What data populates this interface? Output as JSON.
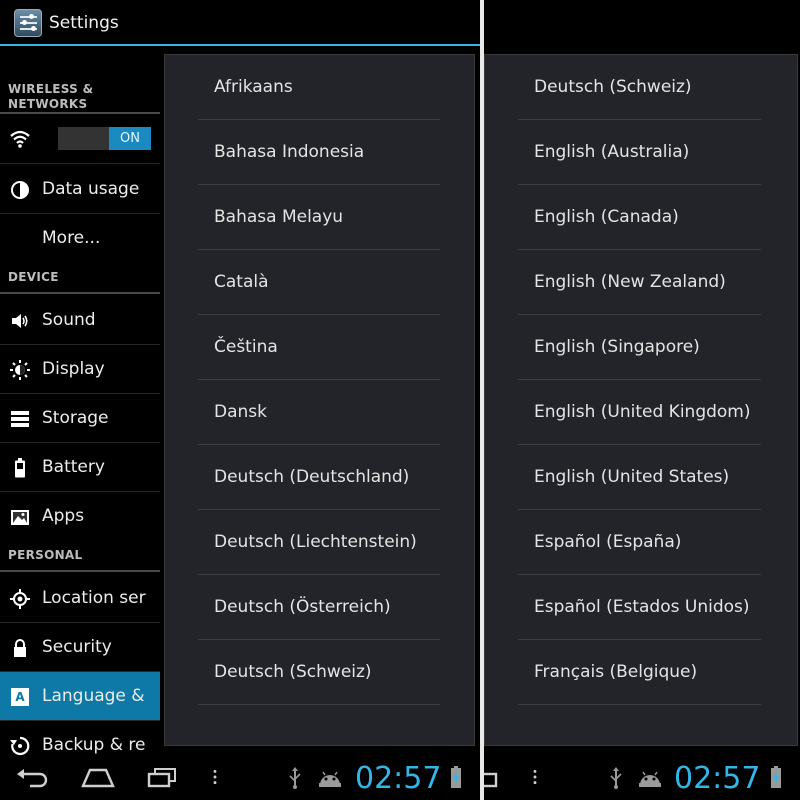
{
  "left_screen": {
    "title": "Settings",
    "sections": [
      {
        "header": "WIRELESS &\nNETWORKS"
      },
      {
        "header": "DEVICE"
      },
      {
        "header": "PERSONAL"
      }
    ],
    "wifi_toggle": "ON",
    "menu": {
      "data_usage": "Data usage",
      "more": "More...",
      "sound": "Sound",
      "display": "Display",
      "storage": "Storage",
      "battery": "Battery",
      "apps": "Apps",
      "location": "Location services",
      "security": "Security",
      "language": "Language & input",
      "backup": "Backup & reset"
    },
    "languages": [
      "Afrikaans",
      "Bahasa Indonesia",
      "Bahasa Melayu",
      "Català",
      "Čeština",
      "Dansk",
      "Deutsch (Deutschland)",
      "Deutsch (Liechtenstein)",
      "Deutsch (Österreich)",
      "Deutsch (Schweiz)"
    ],
    "clock": "02:57"
  },
  "right_screen": {
    "languages": [
      "Deutsch (Schweiz)",
      "English (Australia)",
      "English (Canada)",
      "English (New Zealand)",
      "English (Singapore)",
      "English (United Kingdom)",
      "English (United States)",
      "Español (España)",
      "Español (Estados Unidos)",
      "Français (Belgique)"
    ],
    "clock": "02:57"
  },
  "colors": {
    "accent": "#33b5e5",
    "active_item": "#0e79a7",
    "panel": "#23232a"
  },
  "icons": {
    "back": "back-icon",
    "home": "home-icon",
    "recents": "recent-apps-icon",
    "menu": "overflow-menu-icon",
    "usb": "usb-icon",
    "android": "android-debug-icon",
    "battery": "battery-charging-icon"
  }
}
